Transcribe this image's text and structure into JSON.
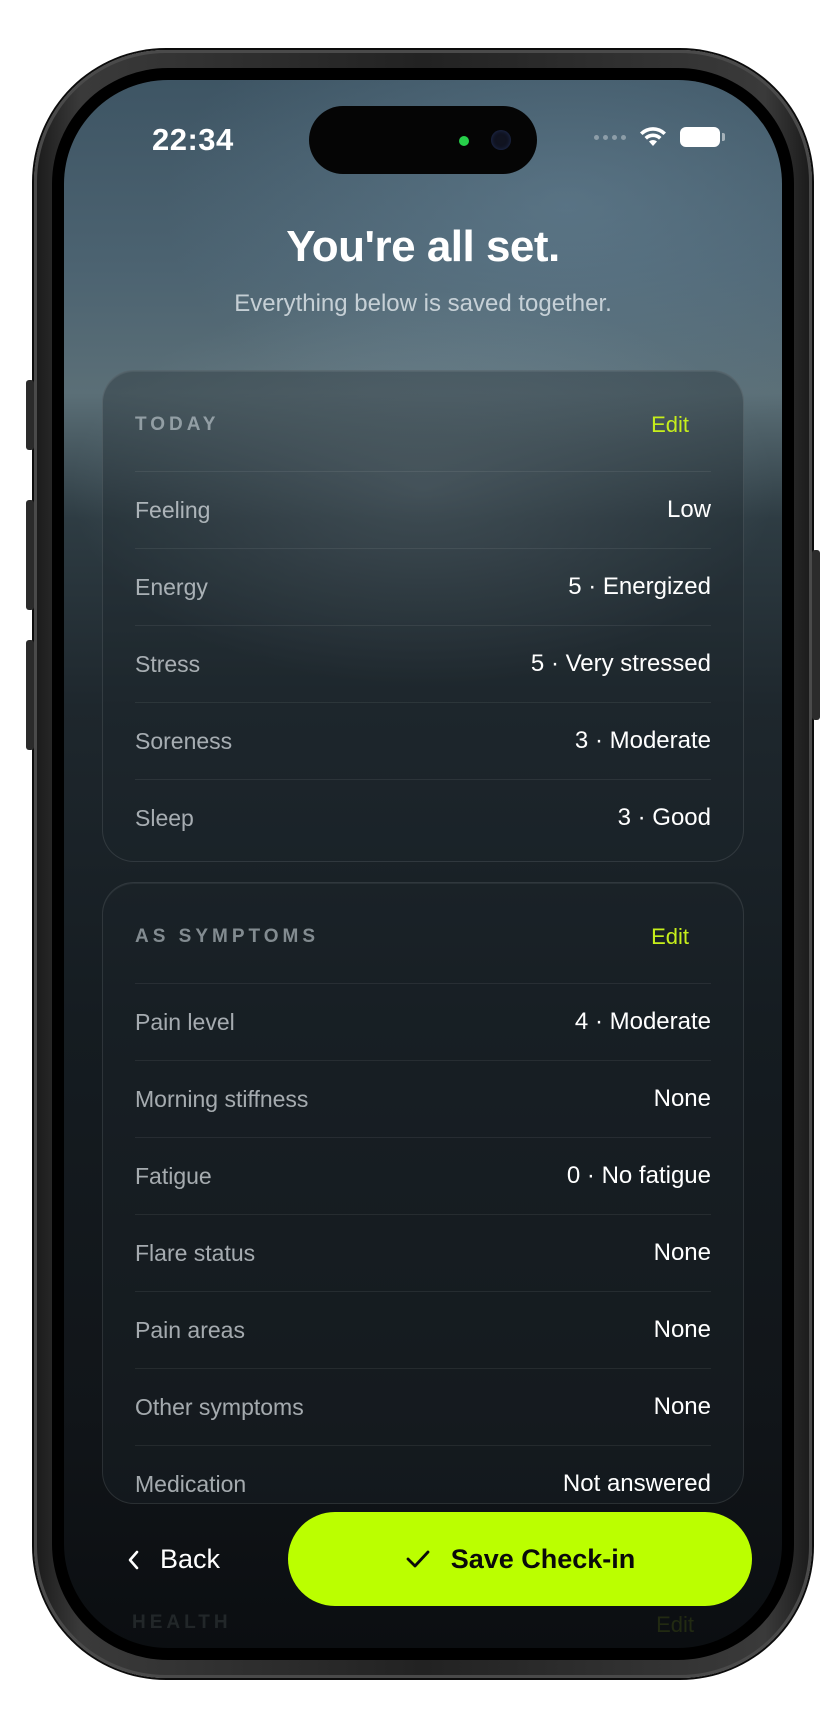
{
  "status_bar": {
    "time": "22:34"
  },
  "header": {
    "title": "You're all set.",
    "subtitle": "Everything below is saved together."
  },
  "sections": [
    {
      "title": "TODAY",
      "edit_label": "Edit",
      "rows": [
        {
          "label": "Feeling",
          "value": "Low"
        },
        {
          "label": "Energy",
          "value": "5 · Energized"
        },
        {
          "label": "Stress",
          "value": "5 · Very stressed"
        },
        {
          "label": "Soreness",
          "value": "3 · Moderate"
        },
        {
          "label": "Sleep",
          "value": "3 · Good"
        }
      ]
    },
    {
      "title": "AS SYMPTOMS",
      "edit_label": "Edit",
      "rows": [
        {
          "label": "Pain level",
          "value": "4 · Moderate"
        },
        {
          "label": "Morning stiffness",
          "value": "None"
        },
        {
          "label": "Fatigue",
          "value": "0 · No fatigue"
        },
        {
          "label": "Flare status",
          "value": "None"
        },
        {
          "label": "Pain areas",
          "value": "None"
        },
        {
          "label": "Other symptoms",
          "value": "None"
        },
        {
          "label": "Medication",
          "value": "Not answered"
        }
      ]
    },
    {
      "title": "HEALTH",
      "edit_label": "Edit"
    }
  ],
  "footer": {
    "back_label": "Back",
    "save_label": "Save Check-in"
  },
  "colors": {
    "accent": "#bbff00",
    "edit": "#c6ee1b"
  }
}
